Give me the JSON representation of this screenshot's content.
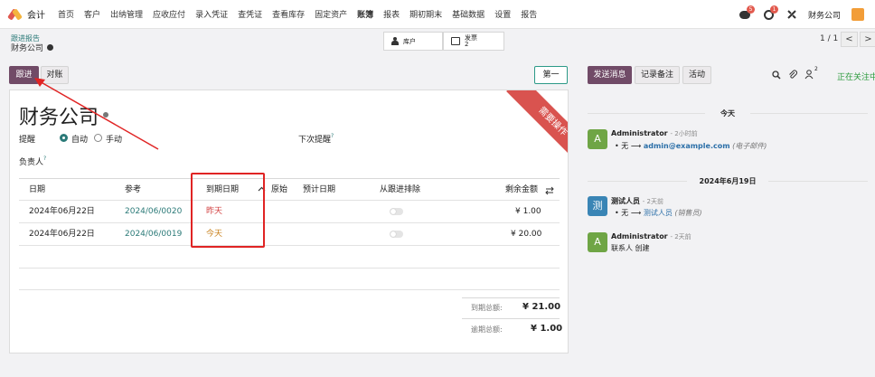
{
  "nav": {
    "app_name": "会计",
    "menu": [
      "首页",
      "客户",
      "出纳管理",
      "应收应付",
      "录入凭证",
      "查凭证",
      "查看库存",
      "固定资产",
      "账簿",
      "报表",
      "期初期末",
      "基础数据",
      "设置",
      "报告"
    ],
    "messages_count": "5",
    "activities_count": "1",
    "company": "财务公司"
  },
  "breadcrumb": {
    "parent": "跟进报告",
    "current": "财务公司"
  },
  "stats": {
    "customer_label": "库户",
    "invoice_label": "发票",
    "invoice_count": "2"
  },
  "pager": {
    "text": "1 / 1",
    "prev": "<",
    "next": ">"
  },
  "statusbar": {
    "followup": "跟进",
    "reconcile": "对账",
    "first": "第一"
  },
  "form": {
    "ribbon": "需要操作",
    "partner_name": "财务公司",
    "reminder_label": "提醒",
    "auto_label": "自动",
    "manual_label": "手动",
    "next_reminder_label": "下次提醒",
    "responsible_label": "负责人",
    "help_mark": "?",
    "columns": [
      "日期",
      "参考",
      "到期日期",
      "原始",
      "预计日期",
      "从跟进排除",
      "剩余金额"
    ],
    "rows": [
      {
        "date": "2024年06月22日",
        "ref": "2024/06/0020",
        "due": "昨天",
        "amount": "¥ 1.00"
      },
      {
        "date": "2024年06月22日",
        "ref": "2024/06/0019",
        "due": "今天",
        "amount": "¥ 20.00"
      }
    ],
    "total_due_label": "到期总额:",
    "total_due": "¥ 21.00",
    "total_overdue_label": "逾期总额:",
    "total_overdue": "¥ 1.00"
  },
  "chatter": {
    "send_message": "发送消息",
    "log_note": "记录备注",
    "activity": "活动",
    "followers_count": "2",
    "following": "正在关注中",
    "today": "今天",
    "date2": "2024年6月19日",
    "messages": [
      {
        "avatar": "A",
        "author": "Administrator",
        "time": "- 2小时前",
        "old": "无",
        "new": "admin@example.com",
        "field": "(电子邮件)"
      },
      {
        "avatar": "测",
        "author": "测试人员",
        "time": "- 2天前",
        "old": "无",
        "new": "测试人员",
        "field": "(销售员)"
      },
      {
        "avatar": "A",
        "author": "Administrator",
        "time": "- 2天前",
        "body": "联系人 创建"
      }
    ]
  },
  "colors": {
    "primary": "#714b67",
    "accent": "#2b7a78",
    "ribbon": "#d9534f",
    "highlight": "#e02424"
  }
}
